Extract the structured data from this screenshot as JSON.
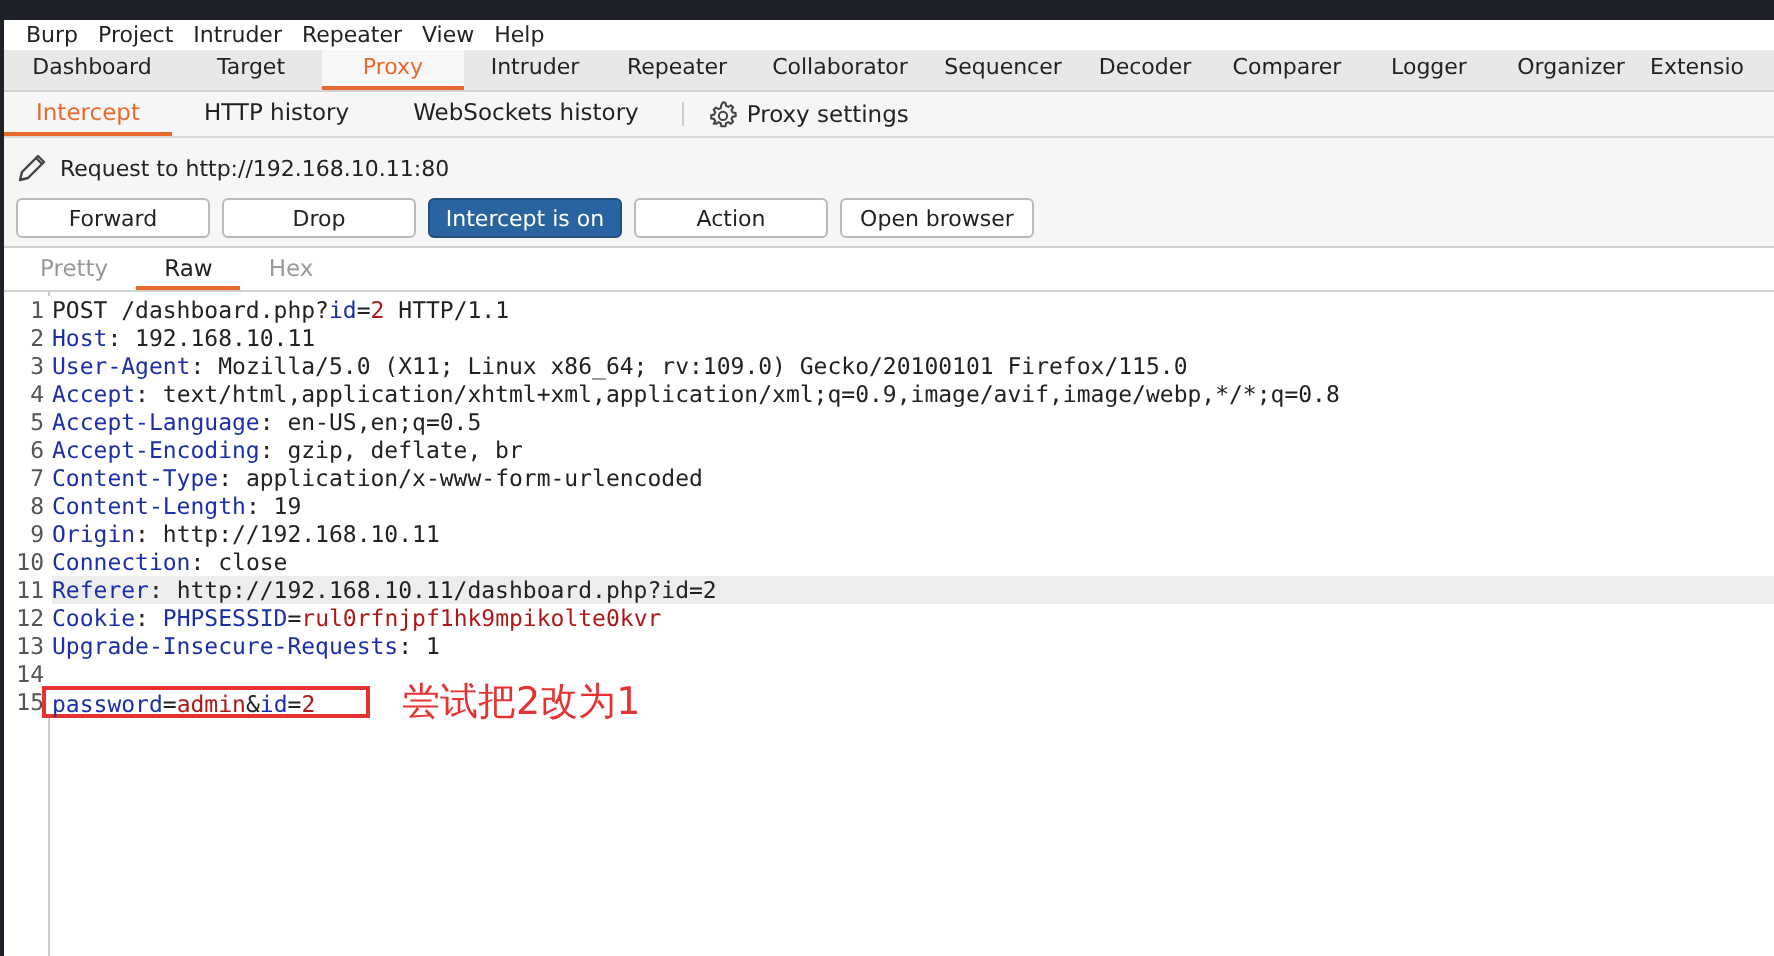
{
  "menu_bar": [
    "Burp",
    "Project",
    "Intruder",
    "Repeater",
    "View",
    "Help"
  ],
  "main_tabs": [
    {
      "label": "Dashboard",
      "selected": false
    },
    {
      "label": "Target",
      "selected": false
    },
    {
      "label": "Proxy",
      "selected": true
    },
    {
      "label": "Intruder",
      "selected": false
    },
    {
      "label": "Repeater",
      "selected": false
    },
    {
      "label": "Collaborator",
      "selected": false
    },
    {
      "label": "Sequencer",
      "selected": false
    },
    {
      "label": "Decoder",
      "selected": false
    },
    {
      "label": "Comparer",
      "selected": false
    },
    {
      "label": "Logger",
      "selected": false
    },
    {
      "label": "Organizer",
      "selected": false
    },
    {
      "label": "Extensio",
      "selected": false
    }
  ],
  "sub_tabs": [
    {
      "label": "Intercept",
      "selected": true
    },
    {
      "label": "HTTP history",
      "selected": false
    },
    {
      "label": "WebSockets history",
      "selected": false
    }
  ],
  "proxy_settings": "Proxy settings",
  "request_target": "Request to http://192.168.10.11:80",
  "buttons": [
    {
      "label": "Forward",
      "on": false
    },
    {
      "label": "Drop",
      "on": false
    },
    {
      "label": "Intercept is on",
      "on": true
    },
    {
      "label": "Action",
      "on": false
    },
    {
      "label": "Open browser",
      "on": false
    }
  ],
  "editor_tabs": [
    {
      "label": "Pretty",
      "selected": false
    },
    {
      "label": "Raw",
      "selected": true
    },
    {
      "label": "Hex",
      "selected": false
    }
  ],
  "lines": [
    {
      "number": "1",
      "highlighted": false,
      "segments": [
        {
          "kind": "plain",
          "text": "POST /dashboard.php?"
        },
        {
          "kind": "key",
          "text": "id"
        },
        {
          "kind": "plain",
          "text": "="
        },
        {
          "kind": "value",
          "text": "2"
        },
        {
          "kind": "plain",
          "text": " HTTP/1.1"
        }
      ]
    },
    {
      "number": "2",
      "highlighted": false,
      "segments": [
        {
          "kind": "key",
          "text": "Host"
        },
        {
          "kind": "plain",
          "text": ": 192.168.10.11"
        }
      ]
    },
    {
      "number": "3",
      "highlighted": false,
      "segments": [
        {
          "kind": "key",
          "text": "User-Agent"
        },
        {
          "kind": "plain",
          "text": ": Mozilla/5.0 (X11; Linux x86_64; rv:109.0) Gecko/20100101 Firefox/115.0"
        }
      ]
    },
    {
      "number": "4",
      "highlighted": false,
      "segments": [
        {
          "kind": "key",
          "text": "Accept"
        },
        {
          "kind": "plain",
          "text": ": text/html,application/xhtml+xml,application/xml;q=0.9,image/avif,image/webp,*/*;q=0.8"
        }
      ]
    },
    {
      "number": "5",
      "highlighted": false,
      "segments": [
        {
          "kind": "key",
          "text": "Accept-Language"
        },
        {
          "kind": "plain",
          "text": ": en-US,en;q=0.5"
        }
      ]
    },
    {
      "number": "6",
      "highlighted": false,
      "segments": [
        {
          "kind": "key",
          "text": "Accept-Encoding"
        },
        {
          "kind": "plain",
          "text": ": gzip, deflate, br"
        }
      ]
    },
    {
      "number": "7",
      "highlighted": false,
      "segments": [
        {
          "kind": "key",
          "text": "Content-Type"
        },
        {
          "kind": "plain",
          "text": ": application/x-www-form-urlencoded"
        }
      ]
    },
    {
      "number": "8",
      "highlighted": false,
      "segments": [
        {
          "kind": "key",
          "text": "Content-Length"
        },
        {
          "kind": "plain",
          "text": ": 19"
        }
      ]
    },
    {
      "number": "9",
      "highlighted": false,
      "segments": [
        {
          "kind": "key",
          "text": "Origin"
        },
        {
          "kind": "plain",
          "text": ": http://192.168.10.11"
        }
      ]
    },
    {
      "number": "10",
      "highlighted": false,
      "segments": [
        {
          "kind": "key",
          "text": "Connection"
        },
        {
          "kind": "plain",
          "text": ": close"
        }
      ]
    },
    {
      "number": "11",
      "highlighted": true,
      "segments": [
        {
          "kind": "key",
          "text": "Referer"
        },
        {
          "kind": "plain",
          "text": ": http://192.168.10.11/dashboard.php?id=2"
        }
      ]
    },
    {
      "number": "12",
      "highlighted": false,
      "segments": [
        {
          "kind": "key",
          "text": "Cookie"
        },
        {
          "kind": "plain",
          "text": ": "
        },
        {
          "kind": "key",
          "text": "PHPSESSID"
        },
        {
          "kind": "plain",
          "text": "="
        },
        {
          "kind": "value",
          "text": "rul0rfnjpf1hk9mpikolte0kvr"
        }
      ]
    },
    {
      "number": "13",
      "highlighted": false,
      "segments": [
        {
          "kind": "key",
          "text": "Upgrade-Insecure-Requests"
        },
        {
          "kind": "plain",
          "text": ": 1"
        }
      ]
    },
    {
      "number": "14",
      "highlighted": false
    },
    {
      "number": "15",
      "highlighted": false,
      "annotation": "尝试把2改为1",
      "segments": [
        {
          "kind": "key",
          "text": "password"
        },
        {
          "kind": "plain",
          "text": "="
        },
        {
          "kind": "value",
          "text": "admin"
        },
        {
          "kind": "plain",
          "text": "&"
        },
        {
          "kind": "key",
          "text": "id"
        },
        {
          "kind": "plain",
          "text": "="
        },
        {
          "kind": "value",
          "text": "2"
        }
      ]
    }
  ]
}
